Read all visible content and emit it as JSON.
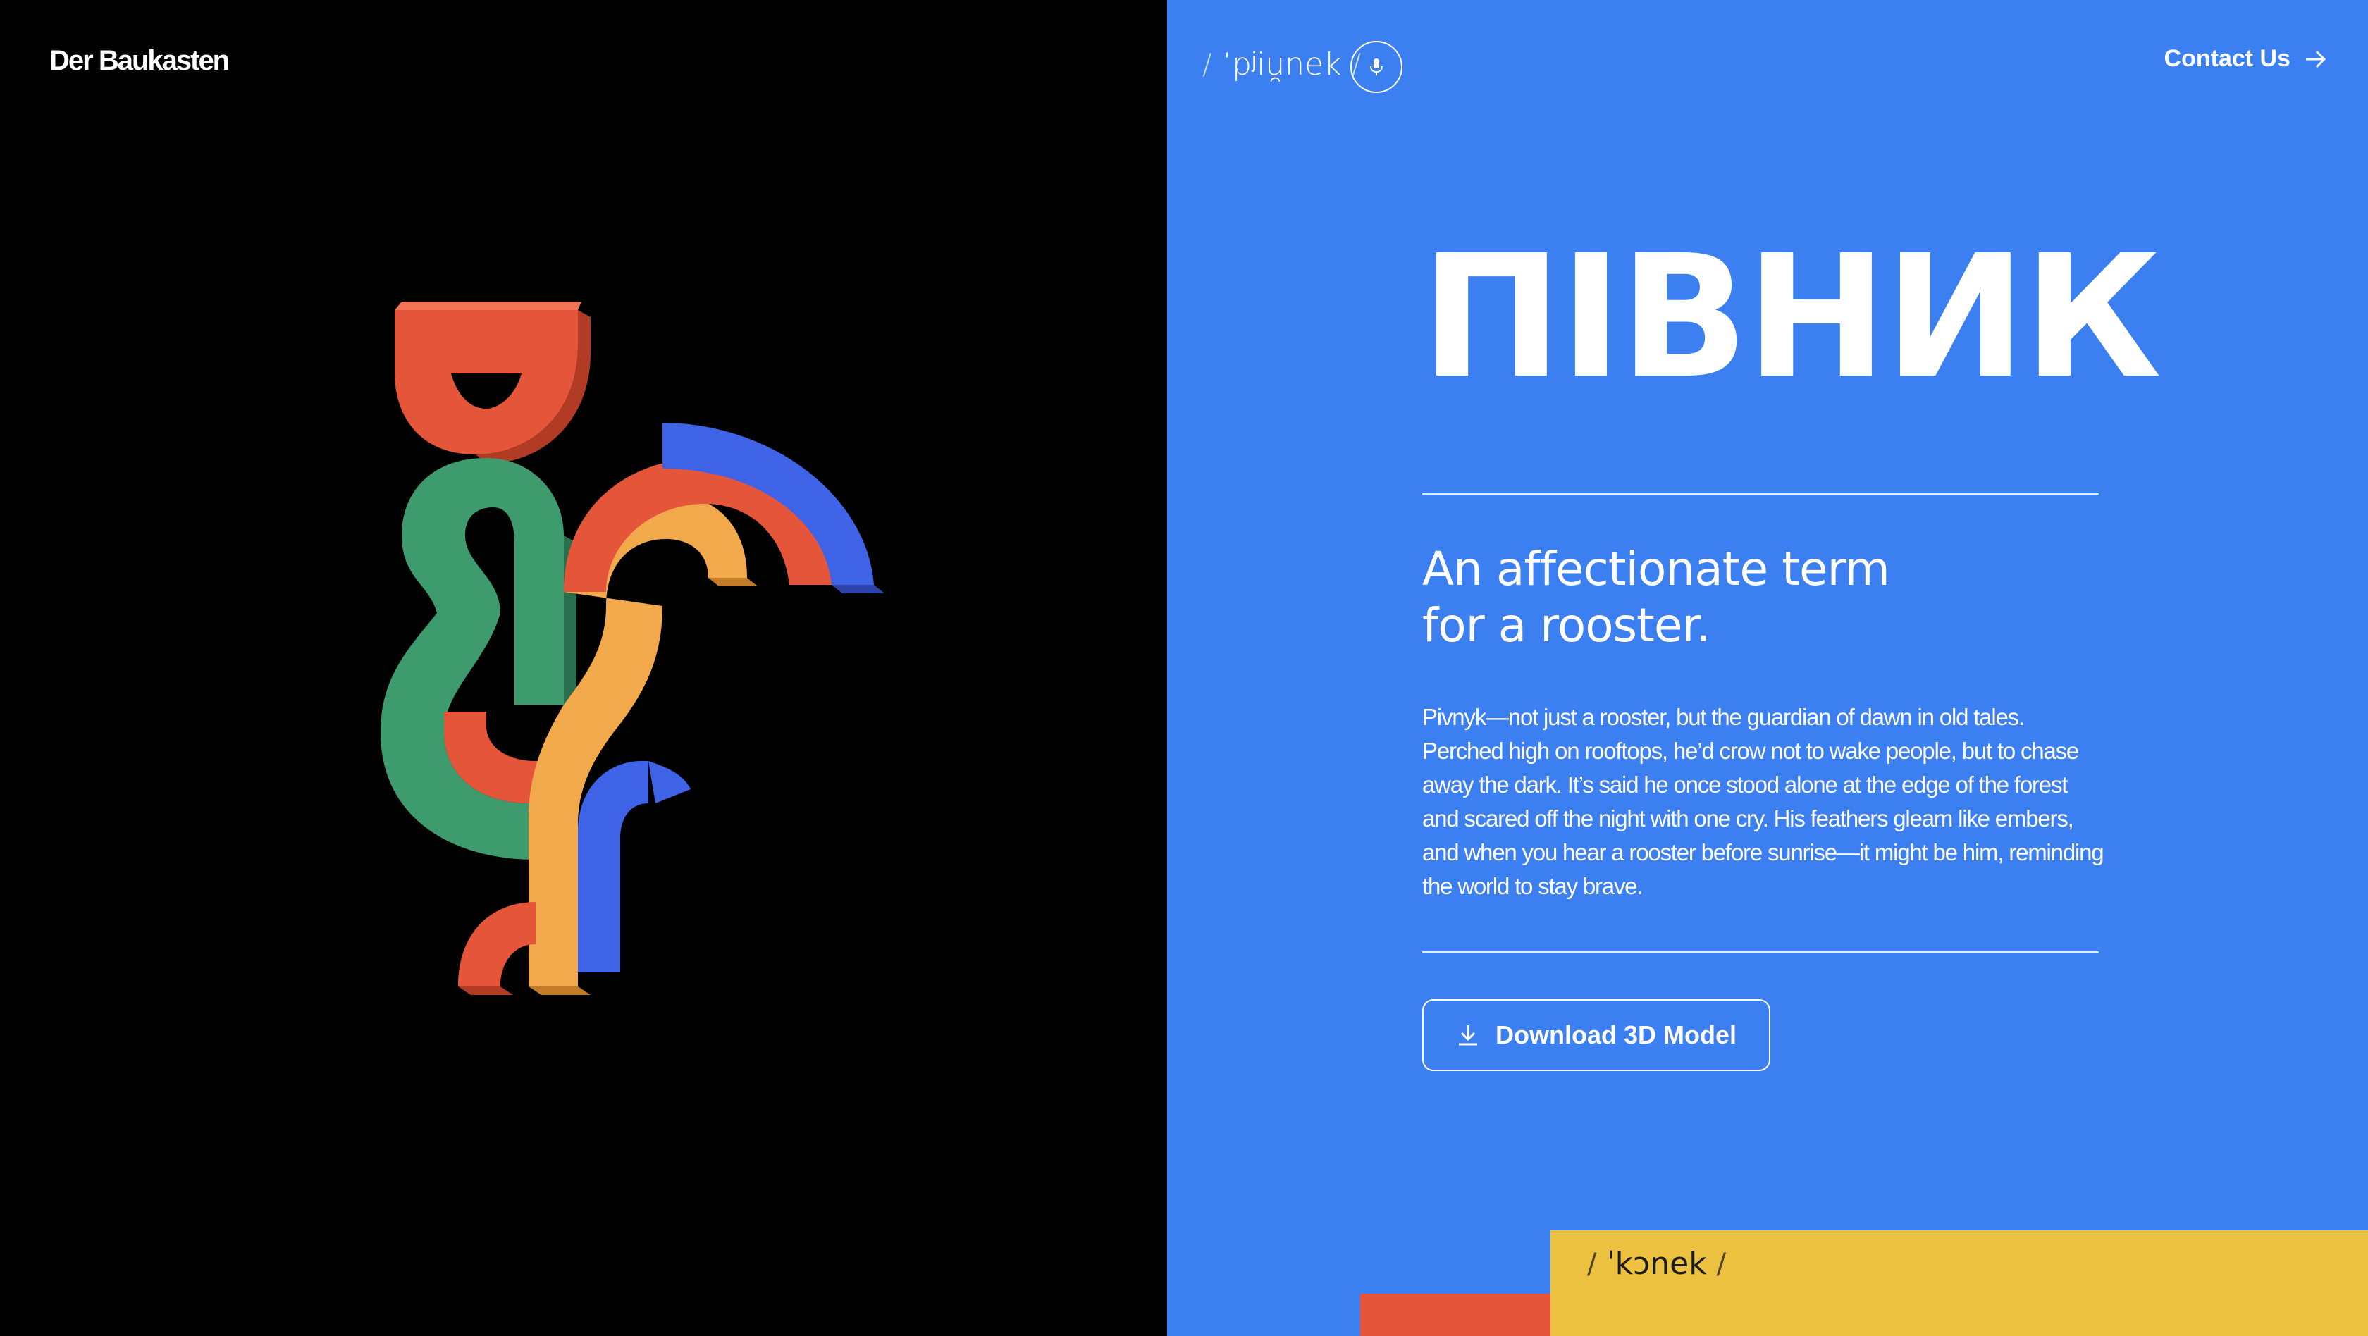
{
  "header": {
    "brand": "Der Baukasten",
    "contact_label": "Contact Us"
  },
  "word": {
    "phonetic": "ˈpʲiu̯nek",
    "slash_left": "/",
    "slash_right": "/",
    "title": "ПІВНИК",
    "subtitle_line1": "An affectionate term",
    "subtitle_line2": "for a rooster.",
    "description": "Pivnyk—not just a rooster, but the guardian of dawn in old tales. Perched high on rooftops, he’d crow not to wake people, but to chase away the dark. It’s said he once stood alone at the edge of the forest and scared off the night with one cry. His feathers gleam like embers, and when you hear a rooster before sunrise—it might be him, reminding the world to stay brave.",
    "download_label": "Download 3D Model"
  },
  "next_word": {
    "phonetic": "ˈkɔnek",
    "slash_left": "/",
    "slash_right": "/"
  },
  "icons": {
    "audio": "microphone-icon",
    "contact_arrow": "arrow-right-icon",
    "download": "download-icon"
  },
  "colors": {
    "left_bg": "#000000",
    "right_bg": "#3c7ff0",
    "red": "#e5553a",
    "green": "#3e9b6e",
    "yellow": "#ebc13f",
    "orange": "#f2a94b",
    "blue": "#3f63e6"
  }
}
